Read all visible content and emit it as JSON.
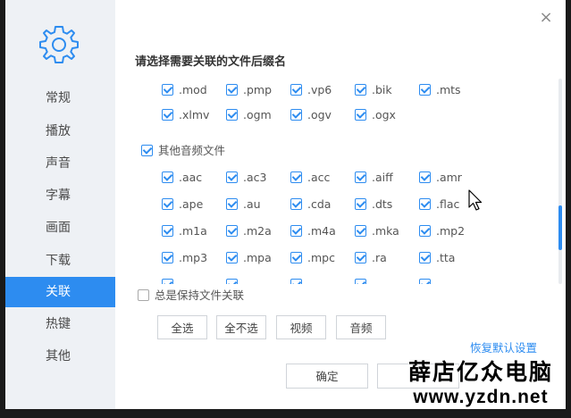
{
  "sidebar": {
    "items": [
      {
        "label": "常规",
        "active": false
      },
      {
        "label": "播放",
        "active": false
      },
      {
        "label": "声音",
        "active": false
      },
      {
        "label": "字幕",
        "active": false
      },
      {
        "label": "画面",
        "active": false
      },
      {
        "label": "下载",
        "active": false
      },
      {
        "label": "关联",
        "active": true
      },
      {
        "label": "热键",
        "active": false
      },
      {
        "label": "其他",
        "active": false
      }
    ]
  },
  "colors": {
    "accent": "#2d8cf0",
    "sidebar_bg": "#eef1f5"
  },
  "icons": {
    "settings": "gear-icon",
    "close": "close-icon",
    "cursor": "mouse-cursor-icon"
  },
  "content": {
    "title": "请选择需要关联的文件后缀名",
    "video_ext": [
      {
        "label": ".mod",
        "checked": true
      },
      {
        "label": ".pmp",
        "checked": true
      },
      {
        "label": ".vp6",
        "checked": true
      },
      {
        "label": ".bik",
        "checked": true
      },
      {
        "label": ".mts",
        "checked": true
      },
      {
        "label": ".xlmv",
        "checked": true
      },
      {
        "label": ".ogm",
        "checked": true
      },
      {
        "label": ".ogv",
        "checked": true
      },
      {
        "label": ".ogx",
        "checked": true
      }
    ],
    "audio_group": {
      "label": "其他音频文件",
      "checked": true
    },
    "audio_ext": [
      {
        "label": ".aac",
        "checked": true
      },
      {
        "label": ".ac3",
        "checked": true
      },
      {
        "label": ".acc",
        "checked": true
      },
      {
        "label": ".aiff",
        "checked": true
      },
      {
        "label": ".amr",
        "checked": true
      },
      {
        "label": ".ape",
        "checked": true
      },
      {
        "label": ".au",
        "checked": true
      },
      {
        "label": ".cda",
        "checked": true
      },
      {
        "label": ".dts",
        "checked": true
      },
      {
        "label": ".flac",
        "checked": true
      },
      {
        "label": ".m1a",
        "checked": true
      },
      {
        "label": ".m2a",
        "checked": true
      },
      {
        "label": ".m4a",
        "checked": true
      },
      {
        "label": ".mka",
        "checked": true
      },
      {
        "label": ".mp2",
        "checked": true
      },
      {
        "label": ".mp3",
        "checked": true
      },
      {
        "label": ".mpa",
        "checked": true
      },
      {
        "label": ".mpc",
        "checked": true
      },
      {
        "label": ".ra",
        "checked": true
      },
      {
        "label": ".tta",
        "checked": true
      }
    ],
    "always_keep": {
      "label": "总是保持文件关联",
      "checked": false
    }
  },
  "buttons": {
    "select_all": "全选",
    "select_none": "全不选",
    "video": "视频",
    "audio": "音频",
    "restore_default": "恢复默认设置",
    "ok": "确定"
  },
  "watermark": {
    "line1": "薛店亿众电脑",
    "line2": "www.yzdn.net"
  }
}
